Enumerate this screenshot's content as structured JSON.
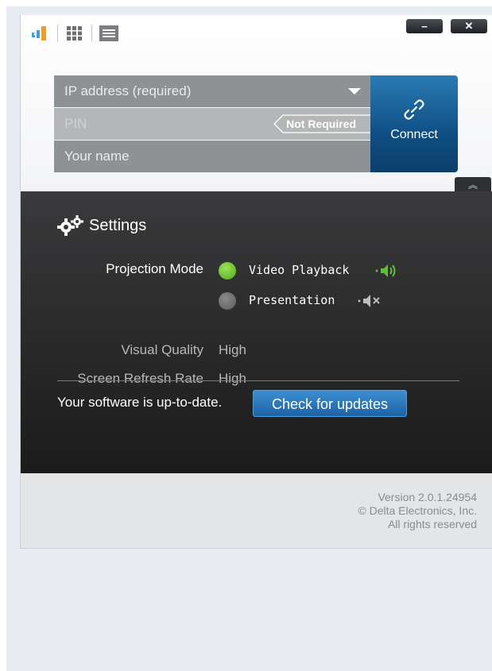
{
  "toolbar": {
    "icons": [
      "signal-bars-icon",
      "grid-icon",
      "list-icon"
    ]
  },
  "window_controls": {
    "minimize": "−",
    "close": "✕"
  },
  "connect_form": {
    "ip_placeholder": "IP address (required)",
    "pin_placeholder": "PIN",
    "pin_badge": "Not Required",
    "name_placeholder": "Your name",
    "connect_label": "Connect"
  },
  "settings": {
    "collapse_glyph": "︽",
    "title": "Settings",
    "projection_mode_label": "Projection Mode",
    "modes": [
      {
        "label": "Video Playback",
        "selected": true,
        "audio": "on"
      },
      {
        "label": "Presentation",
        "selected": false,
        "audio": "muted"
      }
    ],
    "visual_quality_label": "Visual Quality",
    "visual_quality_value": "High",
    "refresh_rate_label": "Screen Refresh Rate",
    "refresh_rate_value": "High",
    "update_status": "Your software is up-to-date.",
    "check_updates_label": "Check for updates"
  },
  "footer": {
    "version": "Version 2.0.1.24954",
    "copyright": "© Delta Electronics, Inc.",
    "rights": "All rights reserved"
  },
  "colors": {
    "accent_blue": "#1d62a6",
    "selected_green": "#5fbf1f",
    "audio_on_green": "#5cc22e",
    "panel_dark": "#1b1b1c"
  }
}
